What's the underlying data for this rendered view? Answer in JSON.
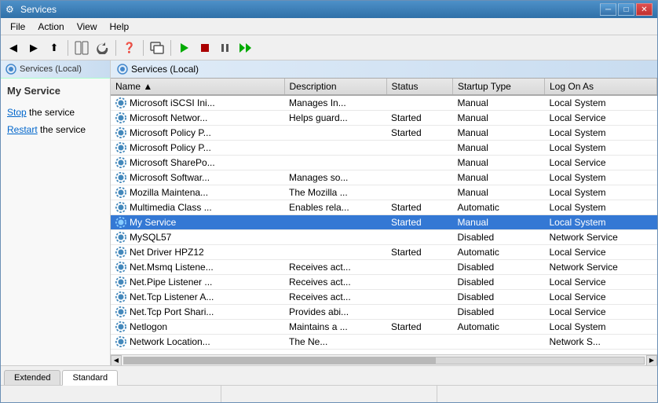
{
  "window": {
    "title": "Services",
    "icon": "⚙"
  },
  "titlebar": {
    "minimize": "─",
    "maximize": "□",
    "close": "✕"
  },
  "menubar": {
    "items": [
      "File",
      "Action",
      "View",
      "Help"
    ]
  },
  "toolbar": {
    "buttons": [
      "◀",
      "▶",
      "⬆",
      "↑",
      "↓",
      "❓",
      "▭",
      "▶",
      "■",
      "⏸",
      "▶▶"
    ]
  },
  "leftpanel": {
    "header": "Services (Local)",
    "service_title": "My Service",
    "stop_label": "Stop",
    "stop_text": " the service",
    "restart_label": "Restart",
    "restart_text": " the service"
  },
  "rightpanel": {
    "header": "Services (Local)"
  },
  "table": {
    "columns": [
      "Name",
      "Description",
      "Status",
      "Startup Type",
      "Log On As"
    ],
    "rows": [
      {
        "icon": "gear",
        "name": "Microsoft iSCSI Ini...",
        "description": "Manages In...",
        "status": "",
        "startup": "Manual",
        "logon": "Local System"
      },
      {
        "icon": "gear",
        "name": "Microsoft Networ...",
        "description": "Helps guard...",
        "status": "Started",
        "startup": "Manual",
        "logon": "Local Service"
      },
      {
        "icon": "gear",
        "name": "Microsoft Policy P...",
        "description": "",
        "status": "Started",
        "startup": "Manual",
        "logon": "Local System"
      },
      {
        "icon": "gear",
        "name": "Microsoft Policy P...",
        "description": "",
        "status": "",
        "startup": "Manual",
        "logon": "Local System"
      },
      {
        "icon": "gear",
        "name": "Microsoft SharePo...",
        "description": "",
        "status": "",
        "startup": "Manual",
        "logon": "Local Service"
      },
      {
        "icon": "gear",
        "name": "Microsoft Softwar...",
        "description": "Manages so...",
        "status": "",
        "startup": "Manual",
        "logon": "Local System"
      },
      {
        "icon": "gear",
        "name": "Mozilla Maintena...",
        "description": "The Mozilla ...",
        "status": "",
        "startup": "Manual",
        "logon": "Local System"
      },
      {
        "icon": "gear",
        "name": "Multimedia Class ...",
        "description": "Enables rela...",
        "status": "Started",
        "startup": "Automatic",
        "logon": "Local System"
      },
      {
        "icon": "gear-selected",
        "name": "My Service",
        "description": "",
        "status": "Started",
        "startup": "Manual",
        "logon": "Local System",
        "selected": true
      },
      {
        "icon": "gear",
        "name": "MySQL57",
        "description": "",
        "status": "",
        "startup": "Disabled",
        "logon": "Network Service"
      },
      {
        "icon": "gear",
        "name": "Net Driver HPZ12",
        "description": "",
        "status": "Started",
        "startup": "Automatic",
        "logon": "Local Service"
      },
      {
        "icon": "gear",
        "name": "Net.Msmq Listene...",
        "description": "Receives act...",
        "status": "",
        "startup": "Disabled",
        "logon": "Network Service"
      },
      {
        "icon": "gear",
        "name": "Net.Pipe Listener ...",
        "description": "Receives act...",
        "status": "",
        "startup": "Disabled",
        "logon": "Local Service"
      },
      {
        "icon": "gear",
        "name": "Net.Tcp Listener A...",
        "description": "Receives act...",
        "status": "",
        "startup": "Disabled",
        "logon": "Local Service"
      },
      {
        "icon": "gear",
        "name": "Net.Tcp Port Shari...",
        "description": "Provides abi...",
        "status": "",
        "startup": "Disabled",
        "logon": "Local Service"
      },
      {
        "icon": "gear",
        "name": "Netlogon",
        "description": "Maintains a ...",
        "status": "Started",
        "startup": "Automatic",
        "logon": "Local System"
      },
      {
        "icon": "gear",
        "name": "Network Location...",
        "description": "The Ne...",
        "status": "",
        "startup": "",
        "logon": "Network S..."
      }
    ]
  },
  "tabs": [
    {
      "label": "Extended",
      "active": false
    },
    {
      "label": "Standard",
      "active": true
    }
  ],
  "statusbar": {
    "segments": [
      "",
      "",
      ""
    ]
  },
  "colors": {
    "selected_bg": "#3478d4",
    "selected_text": "#ffffff",
    "header_bg": "#d8d8d8",
    "window_border": "#6b8fb5"
  }
}
